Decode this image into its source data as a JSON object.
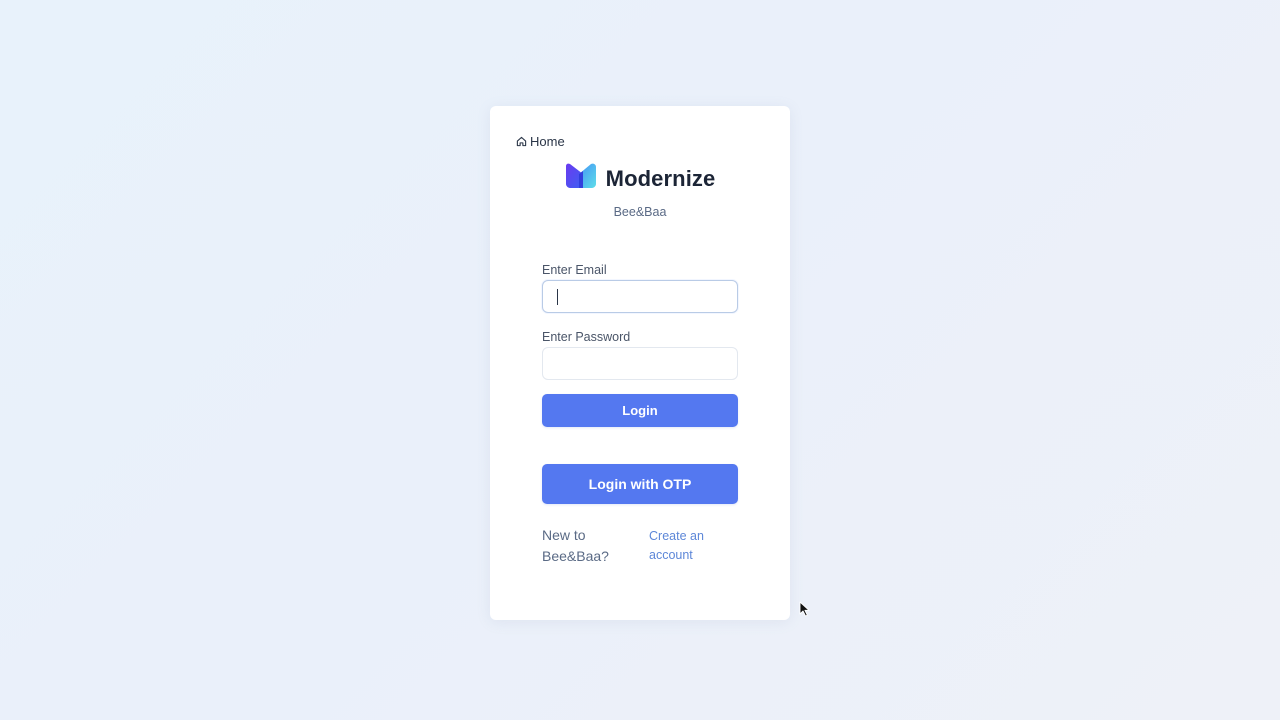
{
  "nav": {
    "home_label": "Home",
    "home_icon": "home-icon"
  },
  "brand": {
    "name": "Modernize",
    "subtitle": "Bee&Baa",
    "logo_colors": [
      "#5d3cf0",
      "#3a8df5",
      "#4fd6e8"
    ]
  },
  "form": {
    "email_label": "Enter Email",
    "email_value": "",
    "password_label": "Enter Password",
    "password_value": "",
    "login_button": "Login",
    "otp_button": "Login with OTP"
  },
  "signup": {
    "question": "New to Bee&Baa?",
    "link": "Create an account"
  },
  "colors": {
    "primary": "#5478f0",
    "link": "#5d87d8",
    "text": "#2a3547"
  }
}
